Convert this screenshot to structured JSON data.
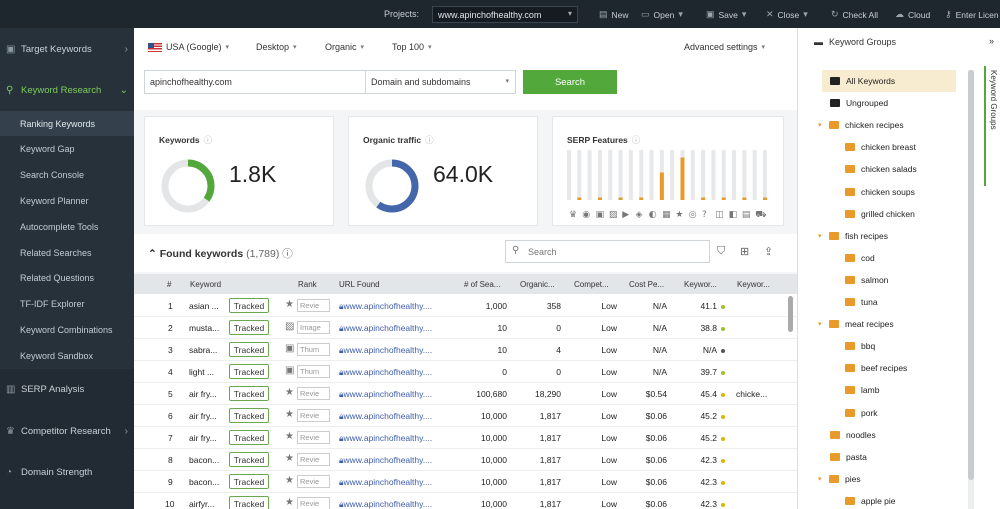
{
  "topbar": {
    "projects_label": "Projects:",
    "project_value": "www.apinchofhealthy.com",
    "buttons": [
      "New",
      "Open",
      "Save",
      "Close",
      "Check All",
      "Cloud",
      "Enter Licen"
    ]
  },
  "sidebar": {
    "target_keywords": "Target Keywords",
    "keyword_research": "Keyword Research",
    "sub_items": [
      "Ranking Keywords",
      "Keyword Gap",
      "Search Console",
      "Keyword Planner",
      "Autocomplete Tools",
      "Related Searches",
      "Related Questions",
      "TF-IDF Explorer",
      "Keyword Combinations",
      "Keyword Sandbox"
    ],
    "serp_analysis": "SERP Analysis",
    "competitor_research": "Competitor Research",
    "domain_strength": "Domain Strength"
  },
  "filters": {
    "country": "USA (Google)",
    "device": "Desktop",
    "type": "Organic",
    "top": "Top 100",
    "advanced": "Advanced settings",
    "domain": "apinchofhealthy.com",
    "scope": "Domain and subdomains",
    "search_button": "Search"
  },
  "cards": {
    "keywords_title": "Keywords",
    "keywords_value": "1.8K",
    "keywords_fill": 0.35,
    "traffic_title": "Organic traffic",
    "traffic_value": "64.0K",
    "traffic_fill": 0.6,
    "serp_title": "SERP Features",
    "serp_levels": [
      0.0,
      0.05,
      0.0,
      0.05,
      0.0,
      0.05,
      0.0,
      0.05,
      0.0,
      0.55,
      0.0,
      0.85,
      0.0,
      0.05,
      0.0,
      0.05,
      0.0,
      0.05,
      0.0,
      0.05
    ]
  },
  "found": {
    "title": "Found keywords",
    "count": "(1,789)",
    "search_placeholder": "Search"
  },
  "table": {
    "headers": [
      "#",
      "Keyword",
      "Rank",
      "URL Found",
      "# of Sea...",
      "Organic...",
      "Compet...",
      "Cost Pe...",
      "Keywor...",
      "Keywor..."
    ],
    "tracked_label": "Tracked",
    "rows": [
      {
        "n": "1",
        "kw": "asian ...",
        "rank_icon": "star",
        "rank_lbl": "Revie",
        "url": "www.apinchofhealthy....",
        "sea": "1,000",
        "org": "358",
        "comp": "Low",
        "cpc": "N/A",
        "kd": "41.1",
        "dot": "#9ac42a",
        "kw2": ""
      },
      {
        "n": "2",
        "kw": "musta...",
        "rank_icon": "image",
        "rank_lbl": "Image",
        "url": "www.apinchofhealthy....",
        "sea": "10",
        "org": "0",
        "comp": "Low",
        "cpc": "N/A",
        "kd": "38.8",
        "dot": "#9ac42a",
        "kw2": ""
      },
      {
        "n": "3",
        "kw": "sabra...",
        "rank_icon": "thumb",
        "rank_lbl": "Thum",
        "url": "www.apinchofhealthy....",
        "sea": "10",
        "org": "4",
        "comp": "Low",
        "cpc": "N/A",
        "kd": "N/A",
        "dot": "#555555",
        "kw2": ""
      },
      {
        "n": "4",
        "kw": "light ...",
        "rank_icon": "thumb",
        "rank_lbl": "Thum",
        "url": "www.apinchofhealthy....",
        "sea": "0",
        "org": "0",
        "comp": "Low",
        "cpc": "N/A",
        "kd": "39.7",
        "dot": "#9ac42a",
        "kw2": ""
      },
      {
        "n": "5",
        "kw": "air fry...",
        "rank_icon": "star",
        "rank_lbl": "Revie",
        "url": "www.apinchofhealthy....",
        "sea": "100,680",
        "org": "18,290",
        "comp": "Low",
        "cpc": "$0.54",
        "kd": "45.4",
        "dot": "#e0b400",
        "kw2": "chicke..."
      },
      {
        "n": "6",
        "kw": "air fry...",
        "rank_icon": "star",
        "rank_lbl": "Revie",
        "url": "www.apinchofhealthy....",
        "sea": "10,000",
        "org": "1,817",
        "comp": "Low",
        "cpc": "$0.06",
        "kd": "45.2",
        "dot": "#e0b400",
        "kw2": ""
      },
      {
        "n": "7",
        "kw": "air fry...",
        "rank_icon": "star",
        "rank_lbl": "Revie",
        "url": "www.apinchofhealthy....",
        "sea": "10,000",
        "org": "1,817",
        "comp": "Low",
        "cpc": "$0.06",
        "kd": "45.2",
        "dot": "#e0b400",
        "kw2": ""
      },
      {
        "n": "8",
        "kw": "bacon...",
        "rank_icon": "star",
        "rank_lbl": "Revie",
        "url": "www.apinchofhealthy....",
        "sea": "10,000",
        "org": "1,817",
        "comp": "Low",
        "cpc": "$0.06",
        "kd": "42.3",
        "dot": "#e0b400",
        "kw2": ""
      },
      {
        "n": "9",
        "kw": "bacon...",
        "rank_icon": "star",
        "rank_lbl": "Revie",
        "url": "www.apinchofhealthy....",
        "sea": "10,000",
        "org": "1,817",
        "comp": "Low",
        "cpc": "$0.06",
        "kd": "42.3",
        "dot": "#e0b400",
        "kw2": ""
      },
      {
        "n": "10",
        "kw": "airfyr...",
        "rank_icon": "star",
        "rank_lbl": "Revie",
        "url": "www.apinchofhealthy....",
        "sea": "10,000",
        "org": "1,817",
        "comp": "Low",
        "cpc": "$0.06",
        "kd": "42.3",
        "dot": "#e0b400",
        "kw2": ""
      }
    ]
  },
  "groups": {
    "title": "Keyword Groups",
    "side_tab": "Keyword Groups",
    "items": [
      {
        "label": "All Keywords",
        "level": 1,
        "type": "dark",
        "selected": true,
        "expand": ""
      },
      {
        "label": "Ungrouped",
        "level": 1,
        "type": "dark",
        "selected": false,
        "expand": ""
      },
      {
        "label": "chicken recipes",
        "level": 0,
        "type": "folder",
        "selected": false,
        "expand": "▾"
      },
      {
        "label": "chicken breast",
        "level": 2,
        "type": "folder",
        "selected": false,
        "expand": ""
      },
      {
        "label": "chicken salads",
        "level": 2,
        "type": "folder",
        "selected": false,
        "expand": ""
      },
      {
        "label": "chicken soups",
        "level": 2,
        "type": "folder",
        "selected": false,
        "expand": ""
      },
      {
        "label": "grilled chicken",
        "level": 2,
        "type": "folder",
        "selected": false,
        "expand": ""
      },
      {
        "label": "fish recipes",
        "level": 0,
        "type": "folder",
        "selected": false,
        "expand": "▾"
      },
      {
        "label": "cod",
        "level": 2,
        "type": "folder",
        "selected": false,
        "expand": ""
      },
      {
        "label": "salmon",
        "level": 2,
        "type": "folder",
        "selected": false,
        "expand": ""
      },
      {
        "label": "tuna",
        "level": 2,
        "type": "folder",
        "selected": false,
        "expand": ""
      },
      {
        "label": "meat recipes",
        "level": 0,
        "type": "folder",
        "selected": false,
        "expand": "▾"
      },
      {
        "label": "bbq",
        "level": 2,
        "type": "folder",
        "selected": false,
        "expand": ""
      },
      {
        "label": "beef recipes",
        "level": 2,
        "type": "folder",
        "selected": false,
        "expand": ""
      },
      {
        "label": "lamb",
        "level": 2,
        "type": "folder",
        "selected": false,
        "expand": ""
      },
      {
        "label": "pork",
        "level": 2,
        "type": "folder",
        "selected": false,
        "expand": ""
      },
      {
        "label": "noodles",
        "level": 1,
        "type": "folder",
        "selected": false,
        "expand": ""
      },
      {
        "label": "pasta",
        "level": 1,
        "type": "folder",
        "selected": false,
        "expand": ""
      },
      {
        "label": "pies",
        "level": 0,
        "type": "folder",
        "selected": false,
        "expand": "▾"
      },
      {
        "label": "apple pie",
        "level": 2,
        "type": "folder",
        "selected": false,
        "expand": ""
      }
    ]
  },
  "colors": {
    "accent_green": "#52a83a",
    "keywords_donut": "#52a83a",
    "traffic_donut": "#4466aa",
    "serp_bar": "#e89a2b",
    "folder": "#e89a2b"
  }
}
